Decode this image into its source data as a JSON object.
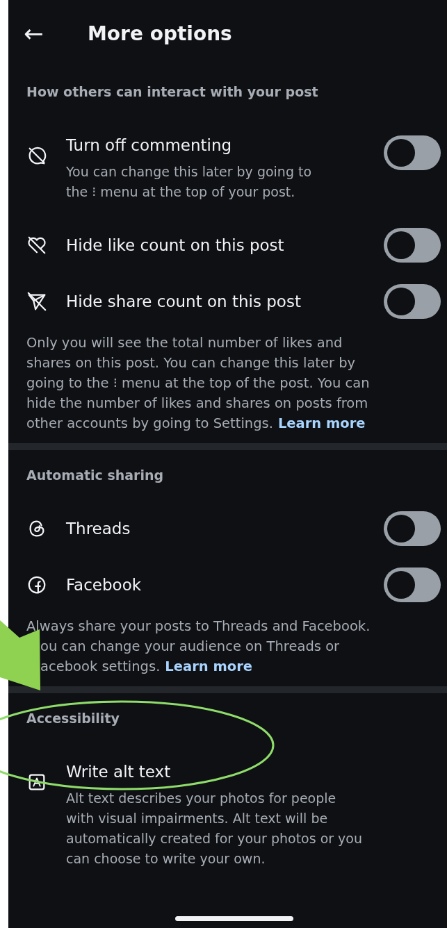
{
  "header": {
    "back": "←",
    "title": "More options"
  },
  "sections": [
    {
      "title": "How others can interact with your post",
      "items": [
        {
          "kind": "toggle",
          "title": "Turn off commenting",
          "subtitle": [
            "You can change this later by going to",
            "the ⁝ menu at the top of your post."
          ],
          "on": false
        },
        {
          "kind": "toggle",
          "title": "Hide like count on this post",
          "on": false
        },
        {
          "kind": "toggle",
          "title": "Hide share count on this post",
          "on": false
        }
      ],
      "note": {
        "lines": [
          "Only you will see the total number of likes and",
          "shares on this post. You can change this later by",
          "going to the ⁝ menu at the top of the post. You can",
          "hide the number of likes and shares on posts from",
          "other accounts by going to Settings."
        ],
        "link": "Learn more"
      }
    },
    {
      "title": "Automatic sharing",
      "items": [
        {
          "kind": "toggle",
          "title": "Threads",
          "on": false
        },
        {
          "kind": "toggle",
          "title": "Facebook",
          "on": false
        }
      ],
      "note": {
        "lines": [
          "Always share your posts to Threads and Facebook.",
          "ou can change your audience on Threads or",
          "acebook settings."
        ],
        "link": "Learn more"
      }
    },
    {
      "title": "Accessibility",
      "items": [
        {
          "kind": "link",
          "title": "Write alt text",
          "subtitle": [
            "Alt text describes your photos for people",
            "with visual impairments. Alt text will be",
            "automatically created for your photos or you",
            "can choose to write your own."
          ]
        }
      ]
    }
  ]
}
